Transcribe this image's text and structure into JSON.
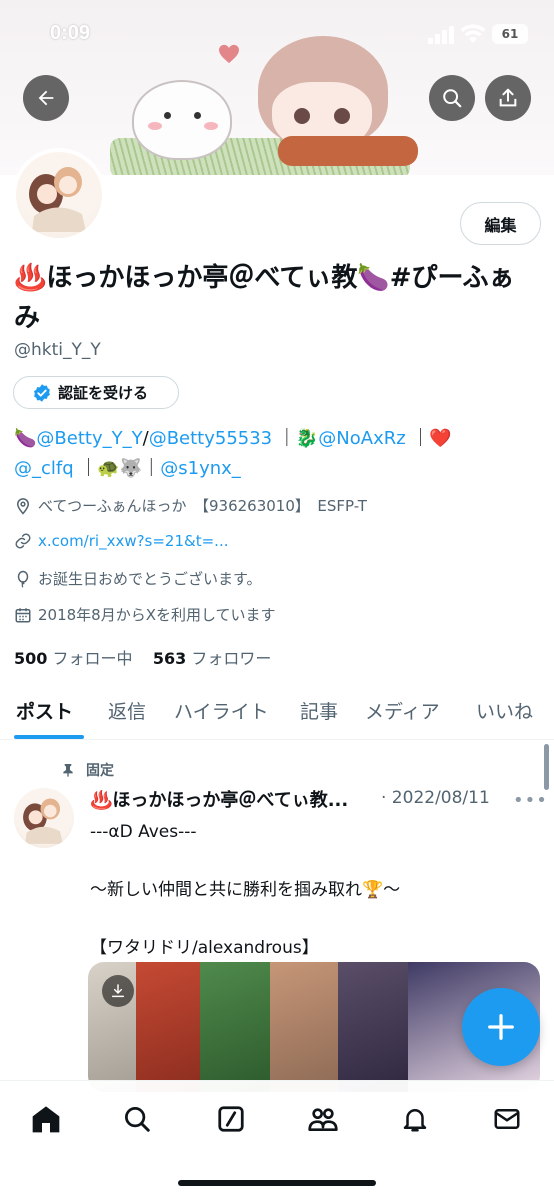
{
  "status_bar": {
    "time": "0:09",
    "battery": "61"
  },
  "profile": {
    "display_name": "♨️ほっかほっか亭＠べてぃ教🍆#ぴーふぁみ",
    "handle": "@hkti_Y_Y",
    "edit_label": "編集",
    "verify_label": "認証を受ける",
    "bio": {
      "emoji1": "🍆",
      "mention1": "@Betty_Y_Y",
      "slash": "/",
      "mention2": "@Betty55533",
      "sep1": "｜🐉",
      "mention3": "@NoAxRz",
      "sep2": "｜❤️",
      "mention4": "@_clfq",
      "sep3": "｜🐢🐺｜",
      "mention5": "@s1ynx_"
    },
    "location": "べてつーふぁんほっか　【936263010】　ESFP-T",
    "website": "x.com/ri_xxw?s=21&t=...",
    "birthday": "お誕生日おめでとうございます。",
    "joined": "2018年8月からXを利用しています",
    "following_count": "500",
    "following_label": "フォロー中",
    "followers_count": "563",
    "followers_label": "フォロワー"
  },
  "tabs": [
    {
      "label": "ポスト"
    },
    {
      "label": "返信"
    },
    {
      "label": "ハイライト"
    },
    {
      "label": "記事"
    },
    {
      "label": "メディア"
    },
    {
      "label": "いいね"
    }
  ],
  "pinned_tweet": {
    "pinned_label": "固定",
    "author": "♨️ほっかほっか亭＠べてぃ教...",
    "date": "· 2022/08/11",
    "more": "•••",
    "body": "---αD Aves---\n\n〜新しい仲間と共に勝利を掴み取れ🏆〜\n\n【ワタリドリ/alexandrous】"
  },
  "colors": {
    "accent": "#1d9bf0",
    "text": "#0f1419",
    "secondary": "#536471"
  }
}
